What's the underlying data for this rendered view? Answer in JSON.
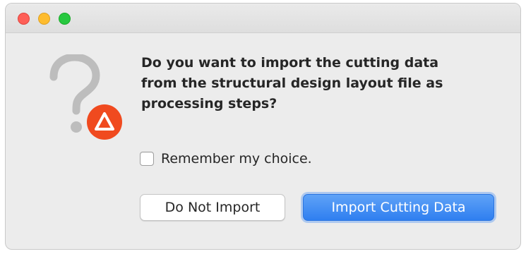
{
  "window": {
    "traffic_lights": {
      "close_color": "#fe5f57",
      "minimize_color": "#febc2e",
      "zoom_color": "#28c840"
    }
  },
  "dialog": {
    "icon": "question-mark-icon",
    "badge_icon": "alert-triangle-icon",
    "badge_color": "#f04a1f",
    "message": "Do you want to import the cutting data\nfrom the structural design layout file as\nprocessing steps?",
    "checkbox": {
      "label": "Remember my choice.",
      "checked": false
    },
    "buttons": {
      "secondary_label": "Do Not Import",
      "primary_label": "Import Cutting Data"
    },
    "accent_color": "#2f7ff0"
  }
}
